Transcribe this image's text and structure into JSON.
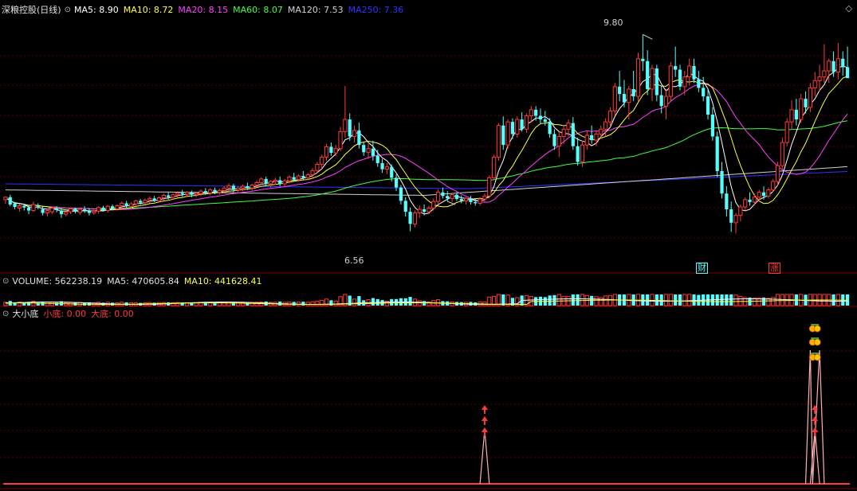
{
  "colors": {
    "bg": "#000000",
    "grid": "#5a0000",
    "up": "#ff3a3a",
    "down": "#54ffff",
    "ma5": "#ffffff",
    "ma10": "#ffff40",
    "ma20": "#ff40ff",
    "ma60": "#40ff40",
    "ma120": "#d0d0d0",
    "ma250": "#3030ff",
    "signal": "#ff3a3a",
    "label": "#c0c0c0"
  },
  "main_panel": {
    "title": "深粮控股(日线)",
    "indicators": [
      {
        "key": "ma5",
        "label": "MA5: 8.90",
        "color": "#ffffff"
      },
      {
        "key": "ma10",
        "label": "MA10: 8.72",
        "color": "#ffff40"
      },
      {
        "key": "ma20",
        "label": "MA20: 8.15",
        "color": "#ff40ff"
      },
      {
        "key": "ma60",
        "label": "MA60: 8.07",
        "color": "#40ff40"
      },
      {
        "key": "ma120",
        "label": "MA120: 7.53",
        "color": "#d0d0d0"
      },
      {
        "key": "ma250",
        "label": "MA250: 7.36",
        "color": "#3030ff"
      }
    ],
    "high_label": "9.80",
    "low_label": "6.56",
    "markers": [
      {
        "text": "财",
        "color": "#54ffff"
      },
      {
        "text": "涨",
        "color": "#ff3a3a"
      }
    ]
  },
  "volume_panel": {
    "title": "VOLUME: 562238.19",
    "ma5": "MA5: 470605.84",
    "ma10": "MA10: 441628.41"
  },
  "signal_panel": {
    "title": "大小底",
    "small": "小底: 0.00",
    "big": "大底: 0.00"
  },
  "chart_data": {
    "type": "candlestick",
    "price_range": [
      6.2,
      10.0
    ],
    "ohlc": [
      [
        7.08,
        7.13,
        7.01,
        7.12
      ],
      [
        7.12,
        7.16,
        6.97,
        7.0
      ],
      [
        7.02,
        7.04,
        6.92,
        6.96
      ],
      [
        6.94,
        7.01,
        6.88,
        6.98
      ],
      [
        6.98,
        7.0,
        6.9,
        6.95
      ],
      [
        6.95,
        6.98,
        6.84,
        6.9
      ],
      [
        6.9,
        7.05,
        6.88,
        7.0
      ],
      [
        6.97,
        7.02,
        6.92,
        6.95
      ],
      [
        6.92,
        6.98,
        6.82,
        6.86
      ],
      [
        6.86,
        6.93,
        6.8,
        6.9
      ],
      [
        6.88,
        6.96,
        6.84,
        6.94
      ],
      [
        6.94,
        6.97,
        6.87,
        6.91
      ],
      [
        6.9,
        6.95,
        6.78,
        6.84
      ],
      [
        6.84,
        6.9,
        6.8,
        6.87
      ],
      [
        6.88,
        6.95,
        6.84,
        6.93
      ],
      [
        6.93,
        6.95,
        6.85,
        6.88
      ],
      [
        6.87,
        6.94,
        6.83,
        6.92
      ],
      [
        6.92,
        6.97,
        6.86,
        6.9
      ],
      [
        6.9,
        6.94,
        6.82,
        6.86
      ],
      [
        6.86,
        6.92,
        6.83,
        6.89
      ],
      [
        6.89,
        6.97,
        6.85,
        6.95
      ],
      [
        6.95,
        6.98,
        6.88,
        6.9
      ],
      [
        6.9,
        6.99,
        6.87,
        6.97
      ],
      [
        6.97,
        7.0,
        6.9,
        6.93
      ],
      [
        6.93,
        7.0,
        6.9,
        6.98
      ],
      [
        6.98,
        7.05,
        6.93,
        7.02
      ],
      [
        7.02,
        7.06,
        6.94,
        6.97
      ],
      [
        6.97,
        7.04,
        6.94,
        7.01
      ],
      [
        7.01,
        7.08,
        6.98,
        7.06
      ],
      [
        7.06,
        7.09,
        7.0,
        7.03
      ],
      [
        7.03,
        7.1,
        7.0,
        7.07
      ],
      [
        7.07,
        7.13,
        7.02,
        7.1
      ],
      [
        7.1,
        7.14,
        7.04,
        7.06
      ],
      [
        7.06,
        7.13,
        7.03,
        7.11
      ],
      [
        7.11,
        7.18,
        7.07,
        7.15
      ],
      [
        7.15,
        7.2,
        7.08,
        7.12
      ],
      [
        7.12,
        7.18,
        7.08,
        7.16
      ],
      [
        7.16,
        7.22,
        7.11,
        7.19
      ],
      [
        7.19,
        7.24,
        7.13,
        7.17
      ],
      [
        7.17,
        7.22,
        7.12,
        7.2
      ],
      [
        7.2,
        7.23,
        7.12,
        7.16
      ],
      [
        7.16,
        7.21,
        7.12,
        7.18
      ],
      [
        7.18,
        7.25,
        7.14,
        7.22
      ],
      [
        7.22,
        7.27,
        7.16,
        7.19
      ],
      [
        7.19,
        7.27,
        7.15,
        7.24
      ],
      [
        7.24,
        7.28,
        7.17,
        7.2
      ],
      [
        7.2,
        7.26,
        7.16,
        7.23
      ],
      [
        7.23,
        7.3,
        7.19,
        7.27
      ],
      [
        7.27,
        7.35,
        7.22,
        7.31
      ],
      [
        7.31,
        7.34,
        7.2,
        7.24
      ],
      [
        7.24,
        7.3,
        7.2,
        7.27
      ],
      [
        7.27,
        7.33,
        7.22,
        7.3
      ],
      [
        7.3,
        7.36,
        7.24,
        7.27
      ],
      [
        7.27,
        7.34,
        7.23,
        7.32
      ],
      [
        7.32,
        7.4,
        7.28,
        7.36
      ],
      [
        7.36,
        7.45,
        7.32,
        7.42
      ],
      [
        7.42,
        7.46,
        7.3,
        7.34
      ],
      [
        7.34,
        7.4,
        7.28,
        7.38
      ],
      [
        7.38,
        7.44,
        7.32,
        7.4
      ],
      [
        7.4,
        7.46,
        7.3,
        7.34
      ],
      [
        7.34,
        7.42,
        7.3,
        7.39
      ],
      [
        7.39,
        7.48,
        7.35,
        7.45
      ],
      [
        7.45,
        7.52,
        7.38,
        7.41
      ],
      [
        7.41,
        7.5,
        7.37,
        7.47
      ],
      [
        7.47,
        7.55,
        7.4,
        7.44
      ],
      [
        7.44,
        7.52,
        7.4,
        7.49
      ],
      [
        7.49,
        7.6,
        7.45,
        7.56
      ],
      [
        7.56,
        7.7,
        7.52,
        7.66
      ],
      [
        7.66,
        7.82,
        7.6,
        7.78
      ],
      [
        7.78,
        8.0,
        7.72,
        7.95
      ],
      [
        7.95,
        8.02,
        7.8,
        7.85
      ],
      [
        7.85,
        7.98,
        7.8,
        7.92
      ],
      [
        7.92,
        8.28,
        7.88,
        8.2
      ],
      [
        8.2,
        8.95,
        8.1,
        8.4
      ],
      [
        8.4,
        8.5,
        8.05,
        8.12
      ],
      [
        8.12,
        8.3,
        8.02,
        8.22
      ],
      [
        8.22,
        8.35,
        7.92,
        7.98
      ],
      [
        7.98,
        8.02,
        7.8,
        7.86
      ],
      [
        7.86,
        8.0,
        7.75,
        7.92
      ],
      [
        7.92,
        8.05,
        7.72,
        7.8
      ],
      [
        7.8,
        7.9,
        7.62,
        7.68
      ],
      [
        7.68,
        7.75,
        7.52,
        7.58
      ],
      [
        7.58,
        7.68,
        7.5,
        7.62
      ],
      [
        7.62,
        7.66,
        7.38,
        7.44
      ],
      [
        7.44,
        7.5,
        7.22,
        7.28
      ],
      [
        7.28,
        7.32,
        7.0,
        7.06
      ],
      [
        7.06,
        7.12,
        6.8,
        6.88
      ],
      [
        6.88,
        6.95,
        6.56,
        6.68
      ],
      [
        6.68,
        6.9,
        6.62,
        6.86
      ],
      [
        6.86,
        6.98,
        6.78,
        6.92
      ],
      [
        6.92,
        7.0,
        6.82,
        6.88
      ],
      [
        6.88,
        6.98,
        6.84,
        6.94
      ],
      [
        6.94,
        7.1,
        6.9,
        7.05
      ],
      [
        7.05,
        7.25,
        7.0,
        7.2
      ],
      [
        7.2,
        7.28,
        7.1,
        7.14
      ],
      [
        7.14,
        7.22,
        7.05,
        7.1
      ],
      [
        7.1,
        7.18,
        7.04,
        7.16
      ],
      [
        7.16,
        7.2,
        7.06,
        7.09
      ],
      [
        7.09,
        7.15,
        7.02,
        7.06
      ],
      [
        7.06,
        7.12,
        7.0,
        7.1
      ],
      [
        7.1,
        7.14,
        7.0,
        7.04
      ],
      [
        7.04,
        7.1,
        6.98,
        7.02
      ],
      [
        7.02,
        7.12,
        6.98,
        7.09
      ],
      [
        7.09,
        7.18,
        7.04,
        7.14
      ],
      [
        7.14,
        7.48,
        7.1,
        7.44
      ],
      [
        7.44,
        7.82,
        7.4,
        7.78
      ],
      [
        7.78,
        8.34,
        7.72,
        8.3
      ],
      [
        8.3,
        8.45,
        7.9,
        7.98
      ],
      [
        7.98,
        8.4,
        7.92,
        8.36
      ],
      [
        8.36,
        8.42,
        8.08,
        8.16
      ],
      [
        8.16,
        8.45,
        8.1,
        8.4
      ],
      [
        8.4,
        8.52,
        8.2,
        8.24
      ],
      [
        8.24,
        8.5,
        8.18,
        8.46
      ],
      [
        8.46,
        8.62,
        8.35,
        8.56
      ],
      [
        8.56,
        8.62,
        8.38,
        8.46
      ],
      [
        8.46,
        8.58,
        8.32,
        8.4
      ],
      [
        8.4,
        8.54,
        8.3,
        8.36
      ],
      [
        8.36,
        8.42,
        8.1,
        8.16
      ],
      [
        8.16,
        8.24,
        7.9,
        7.96
      ],
      [
        7.96,
        8.2,
        7.78,
        8.12
      ],
      [
        8.12,
        8.28,
        8.0,
        8.24
      ],
      [
        8.24,
        8.4,
        8.12,
        8.34
      ],
      [
        8.34,
        8.44,
        7.9,
        7.96
      ],
      [
        7.96,
        8.1,
        7.64,
        7.7
      ],
      [
        7.7,
        8.05,
        7.62,
        7.98
      ],
      [
        7.98,
        8.22,
        7.9,
        8.14
      ],
      [
        8.14,
        8.3,
        8.0,
        8.06
      ],
      [
        8.06,
        8.22,
        7.96,
        8.16
      ],
      [
        8.16,
        8.3,
        8.08,
        8.24
      ],
      [
        8.24,
        8.42,
        8.12,
        8.36
      ],
      [
        8.36,
        8.6,
        8.28,
        8.54
      ],
      [
        8.54,
        9.0,
        8.46,
        8.94
      ],
      [
        8.94,
        9.2,
        8.7,
        8.82
      ],
      [
        8.82,
        9.05,
        8.6,
        8.68
      ],
      [
        8.68,
        8.95,
        8.4,
        8.9
      ],
      [
        8.9,
        9.2,
        8.7,
        8.78
      ],
      [
        8.78,
        9.5,
        8.7,
        9.4
      ],
      [
        9.4,
        9.8,
        9.2,
        9.36
      ],
      [
        9.36,
        9.54,
        8.8,
        8.9
      ],
      [
        8.9,
        9.3,
        8.7,
        9.24
      ],
      [
        9.24,
        9.3,
        8.7,
        8.8
      ],
      [
        8.8,
        8.95,
        8.5,
        8.62
      ],
      [
        8.62,
        8.9,
        8.4,
        8.78
      ],
      [
        8.78,
        9.35,
        8.7,
        9.28
      ],
      [
        9.28,
        9.6,
        9.1,
        9.22
      ],
      [
        9.22,
        9.3,
        8.88,
        8.94
      ],
      [
        8.94,
        9.2,
        8.8,
        9.1
      ],
      [
        9.1,
        9.4,
        8.96,
        9.28
      ],
      [
        9.28,
        9.4,
        9.0,
        9.06
      ],
      [
        9.06,
        9.2,
        8.85,
        8.92
      ],
      [
        8.92,
        9.1,
        8.7,
        8.78
      ],
      [
        8.78,
        8.9,
        8.4,
        8.48
      ],
      [
        8.48,
        8.6,
        8.05,
        8.12
      ],
      [
        8.12,
        8.2,
        7.45,
        7.55
      ],
      [
        7.55,
        7.7,
        7.1,
        7.18
      ],
      [
        7.18,
        7.3,
        6.8,
        6.92
      ],
      [
        6.92,
        7.05,
        6.55,
        6.7
      ],
      [
        6.7,
        6.86,
        6.52,
        6.82
      ],
      [
        6.82,
        7.0,
        6.72,
        6.96
      ],
      [
        6.96,
        7.12,
        6.9,
        7.08
      ],
      [
        7.08,
        7.2,
        6.98,
        7.04
      ],
      [
        7.04,
        7.18,
        6.98,
        7.12
      ],
      [
        7.12,
        7.24,
        7.04,
        7.2
      ],
      [
        7.2,
        7.3,
        7.08,
        7.14
      ],
      [
        7.14,
        7.28,
        7.1,
        7.24
      ],
      [
        7.24,
        7.42,
        7.2,
        7.38
      ],
      [
        7.38,
        7.7,
        7.32,
        7.64
      ],
      [
        7.64,
        8.1,
        7.58,
        8.02
      ],
      [
        8.02,
        8.42,
        7.96,
        8.36
      ],
      [
        8.36,
        8.72,
        8.24,
        8.56
      ],
      [
        8.56,
        8.74,
        8.3,
        8.4
      ],
      [
        8.4,
        8.82,
        8.34,
        8.74
      ],
      [
        8.74,
        8.86,
        8.5,
        8.6
      ],
      [
        8.6,
        9.0,
        8.52,
        8.92
      ],
      [
        8.92,
        9.18,
        8.78,
        9.04
      ],
      [
        9.04,
        9.3,
        8.86,
        9.1
      ],
      [
        9.1,
        9.64,
        9.0,
        9.2
      ],
      [
        9.2,
        9.4,
        9.0,
        9.36
      ],
      [
        9.36,
        9.52,
        9.1,
        9.18
      ],
      [
        9.18,
        9.66,
        9.06,
        9.4
      ],
      [
        9.4,
        9.52,
        9.12,
        9.26
      ],
      [
        9.26,
        9.6,
        9.1,
        9.08
      ]
    ],
    "volume_scale_max": 100,
    "signal_small_peak_index": 103,
    "signal_big_peak_index": 174
  }
}
